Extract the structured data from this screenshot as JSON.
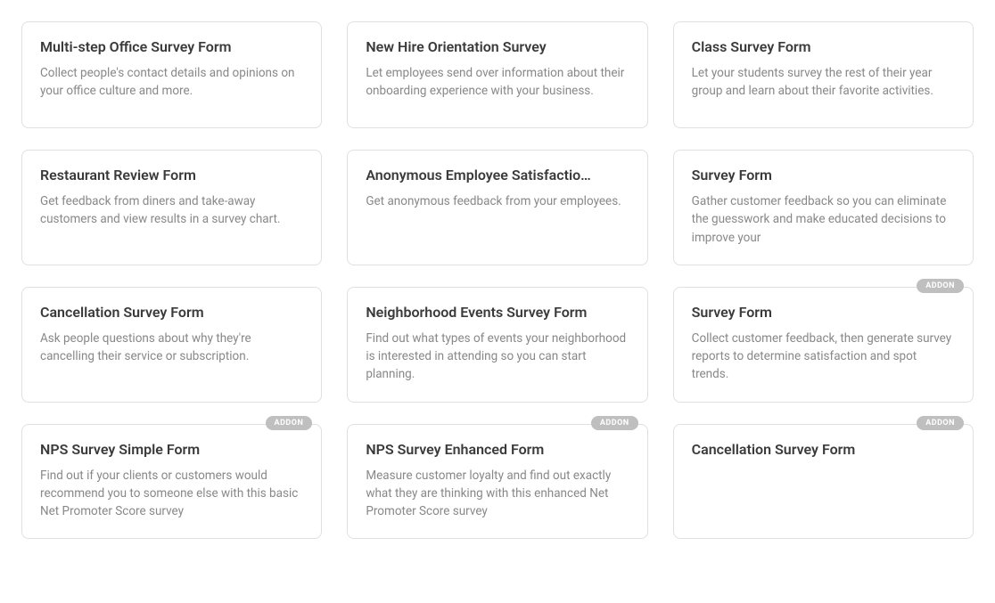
{
  "badge_label": "ADDON",
  "cards": [
    {
      "title": "Multi-step Office Survey Form",
      "description": "Collect people's contact details and opinions on your office culture and more.",
      "addon": false
    },
    {
      "title": "New Hire Orientation Survey",
      "description": "Let employees send over information about their onboarding experience with your business.",
      "addon": false
    },
    {
      "title": "Class Survey Form",
      "description": "Let your students survey the rest of their year group and learn about their favorite activities.",
      "addon": false
    },
    {
      "title": "Restaurant Review Form",
      "description": "Get feedback from diners and take-away customers and view results in a survey chart.",
      "addon": false
    },
    {
      "title": "Anonymous Employee Satisfactio…",
      "description": "Get anonymous feedback from your employees.",
      "addon": false
    },
    {
      "title": "Survey Form",
      "description": "Gather customer feedback so you can eliminate the guesswork and make educated decisions to improve your",
      "addon": false
    },
    {
      "title": "Cancellation Survey Form",
      "description": "Ask people questions about why they're cancelling their service or subscription.",
      "addon": false
    },
    {
      "title": "Neighborhood Events Survey Form",
      "description": "Find out what types of events your neighborhood is interested in attending so you can start planning.",
      "addon": false
    },
    {
      "title": "Survey Form",
      "description": "Collect customer feedback, then generate survey reports to determine satisfaction and spot trends.",
      "addon": true
    },
    {
      "title": "NPS Survey Simple Form",
      "description": "Find out if your clients or customers would recommend you to someone else with this basic Net Promoter Score survey",
      "addon": true
    },
    {
      "title": "NPS Survey Enhanced Form",
      "description": "Measure customer loyalty and find out exactly what they are thinking with this enhanced Net Promoter Score survey",
      "addon": true
    },
    {
      "title": "Cancellation Survey Form",
      "description": "",
      "addon": true
    }
  ]
}
